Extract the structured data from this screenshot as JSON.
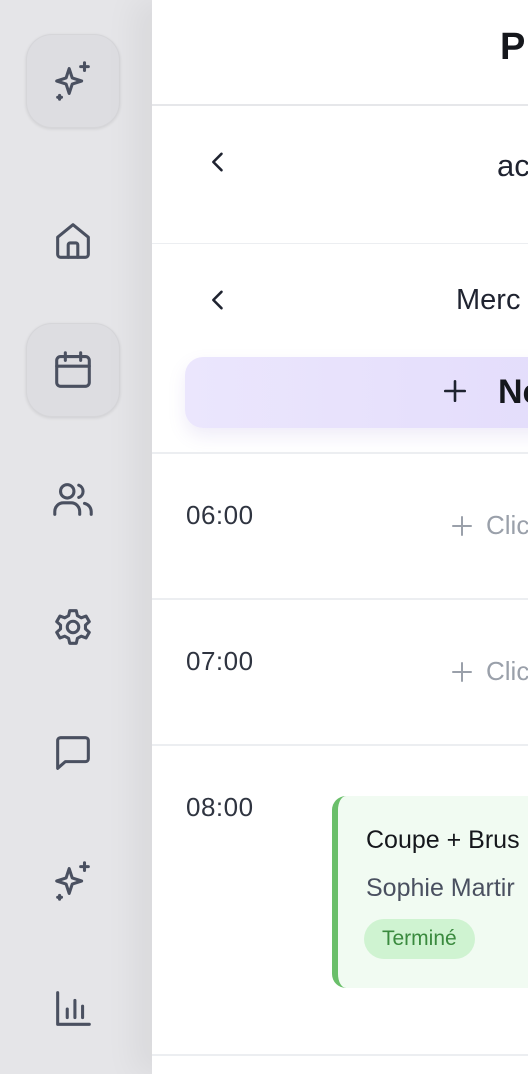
{
  "header": {
    "title": "Pl"
  },
  "nav": {
    "back_label_1": "ac",
    "date_label": "Merc"
  },
  "new_button": {
    "label": "Nc"
  },
  "sidebar": {
    "items": [
      {
        "icon": "sparkles-icon",
        "active": true
      },
      {
        "icon": "home-icon",
        "active": false
      },
      {
        "icon": "calendar-icon",
        "active": true
      },
      {
        "icon": "users-icon",
        "active": false
      },
      {
        "icon": "settings-icon",
        "active": false
      },
      {
        "icon": "chat-icon",
        "active": false
      },
      {
        "icon": "sparkles-icon",
        "active": false
      },
      {
        "icon": "chart-icon",
        "active": false
      }
    ]
  },
  "slots": [
    {
      "time": "06:00",
      "add_label": "Clic"
    },
    {
      "time": "07:00",
      "add_label": "Clic"
    },
    {
      "time": "08:00"
    }
  ],
  "appointment": {
    "service": "Coupe + Brus",
    "client": "Sophie Martir",
    "status": "Terminé",
    "accent_color": "#6abf6a"
  },
  "colors": {
    "sidebar_bg": "#e5e5e8",
    "new_button_bg": "#e6e0fc",
    "status_bg": "#cff3d1",
    "status_text": "#3a8a3e"
  }
}
